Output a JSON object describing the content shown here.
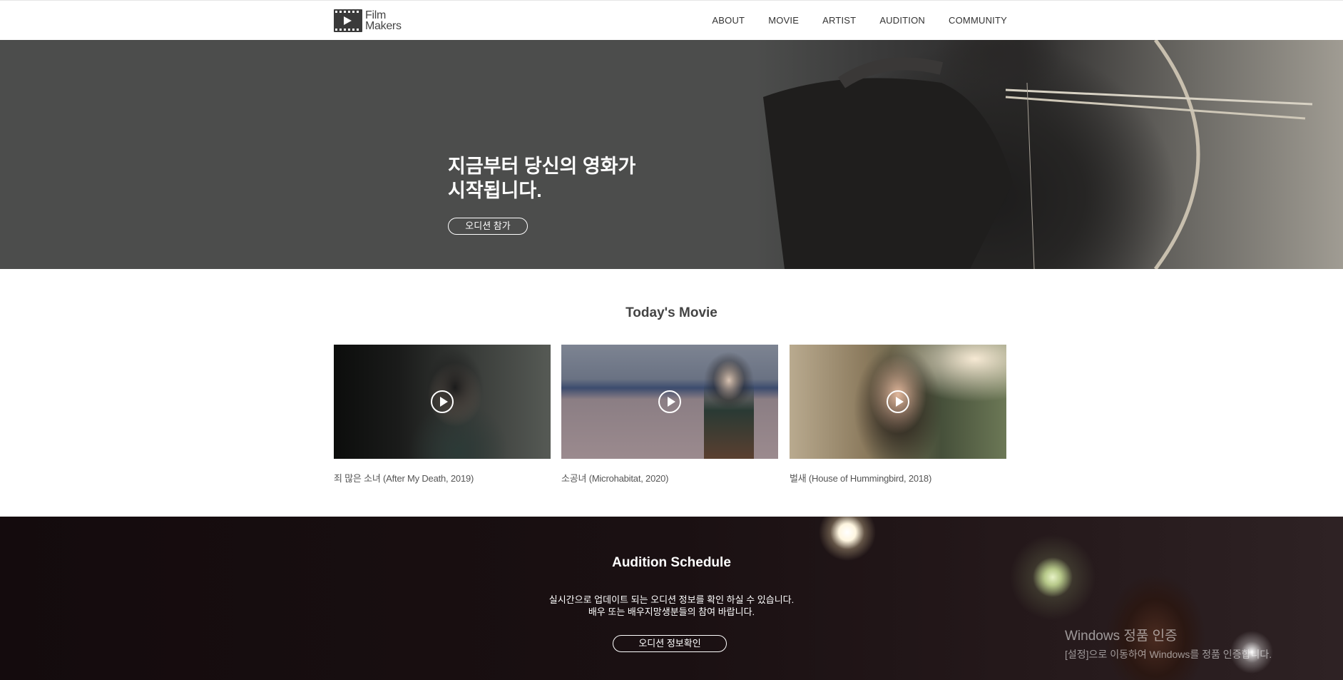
{
  "header": {
    "logo_line1": "Film",
    "logo_line2": "Makers",
    "nav": [
      "ABOUT",
      "MOVIE",
      "ARTIST",
      "AUDITION",
      "COMMUNITY"
    ]
  },
  "hero": {
    "title_line1": "지금부터 당신의 영화가",
    "title_line2": "시작됩니다.",
    "button_label": "오디션 참가"
  },
  "todays_movie": {
    "title": "Today's Movie",
    "movies": [
      {
        "caption": "죄 많은 소녀 (After My Death, 2019)"
      },
      {
        "caption": "소공녀 (Microhabitat, 2020)"
      },
      {
        "caption": "벌새 (House of Hummingbird, 2018)"
      }
    ]
  },
  "audition": {
    "title": "Audition Schedule",
    "desc_line1": "실시간으로 업데이트 되는 오디션 정보를 확인 하실 수 있습니다.",
    "desc_line2": "배우 또는 배우지망생분들의 참여 바랍니다.",
    "button_label": "오디션 정보확인"
  },
  "watermark": {
    "line1": "Windows 정품 인증",
    "line2": "[설정]으로 이동하여 Windows를 정품 인증합니다."
  }
}
